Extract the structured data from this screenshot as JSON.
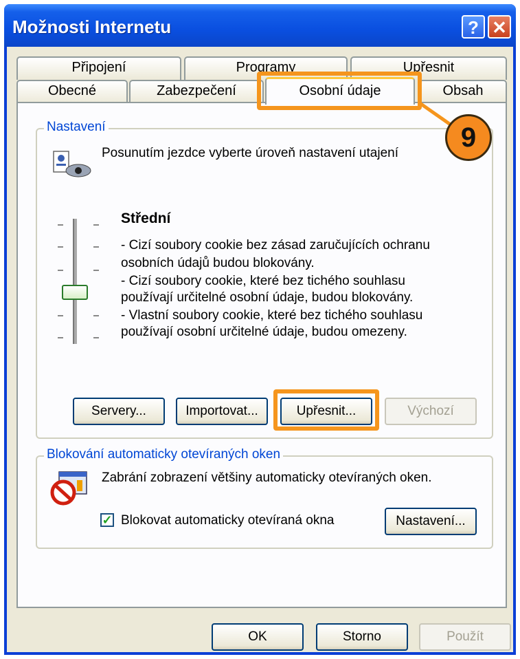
{
  "window": {
    "title": "Možnosti Internetu",
    "help": "?",
    "close": "✕"
  },
  "tabs": {
    "back": [
      "Připojení",
      "Programy",
      "Upřesnit"
    ],
    "front": [
      "Obecné",
      "Zabezpečení",
      "Osobní údaje",
      "Obsah"
    ]
  },
  "settings": {
    "legend": "Nastavení",
    "intro": "Posunutím jezdce vyberte úroveň nastavení utajení",
    "level": "Střední",
    "desc": [
      "- Cizí soubory cookie bez zásad zaručujících ochranu",
      "osobních údajů budou blokovány.",
      "- Cizí soubory cookie, které bez tichého souhlasu",
      "používají určitelné osobní údaje, budou blokovány.",
      "- Vlastní soubory cookie, které bez tichého souhlasu",
      "používají osobní určitelné údaje, budou omezeny."
    ],
    "buttons": {
      "servers": "Servery...",
      "import": "Importovat...",
      "advanced": "Upřesnit...",
      "default": "Výchozí"
    }
  },
  "popup": {
    "legend": "Blokování automaticky otevíraných oken",
    "intro": "Zabrání zobrazení většiny automaticky otevíraných oken.",
    "checkbox": "Blokovat automaticky otevíraná okna",
    "checked": true,
    "settings_button": "Nastavení..."
  },
  "footer": {
    "ok": "OK",
    "cancel": "Storno",
    "apply": "Použít"
  },
  "callout": {
    "number": "9",
    "color": "#f5951d"
  }
}
